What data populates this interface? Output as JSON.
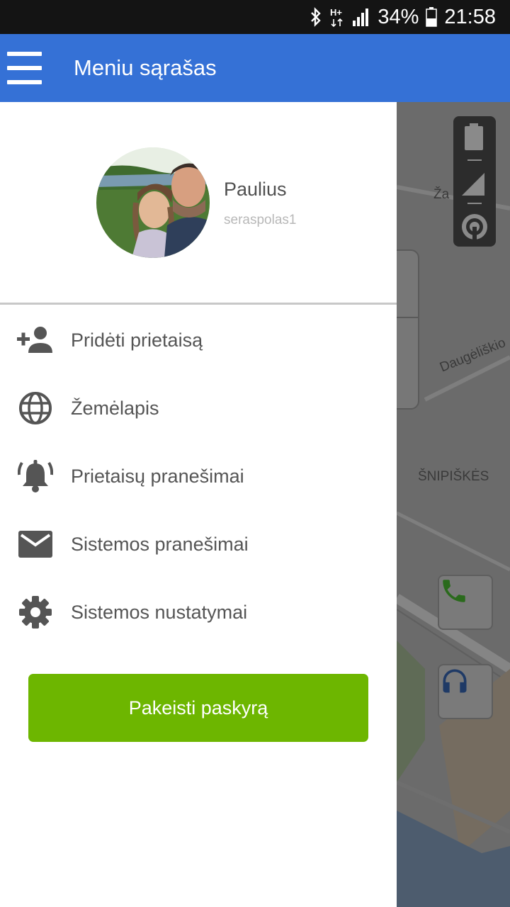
{
  "status_bar": {
    "network": "H+",
    "battery_percent": "34%",
    "time": "21:58",
    "icons": [
      "bluetooth-icon",
      "network-type-icon",
      "signal-icon",
      "battery-icon"
    ]
  },
  "app_bar": {
    "title": "Meniu sąrašas",
    "menu_icon": "hamburger-icon",
    "color": "#3571d6"
  },
  "profile": {
    "name": "Paulius",
    "username": "seraspolas1"
  },
  "menu": {
    "items": [
      {
        "label": "Pridėti prietaisą",
        "icon": "add-person-icon"
      },
      {
        "label": "Žemėlapis",
        "icon": "globe-icon"
      },
      {
        "label": "Prietaisų pranešimai",
        "icon": "bell-alarm-icon"
      },
      {
        "label": "Sistemos pranešimai",
        "icon": "envelope-icon"
      },
      {
        "label": "Sistemos nustatymai",
        "icon": "gear-icon"
      }
    ]
  },
  "switch_account": {
    "label": "Pakeisti paskyrą",
    "color": "#6db600"
  },
  "map": {
    "labels": {
      "street_1": "Ža",
      "street_2": "Daugėliškio",
      "district": "ŠNIPIŠKĖS"
    },
    "buttons": [
      "phone-icon",
      "headphones-icon"
    ]
  }
}
